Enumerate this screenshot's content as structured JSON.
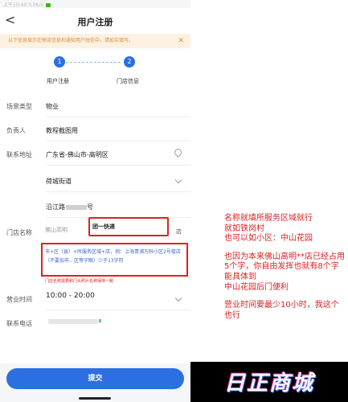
{
  "statusbar": {
    "text": "上午10:40 0.0K/s"
  },
  "navbar": {
    "back": "<",
    "title": "用户注册"
  },
  "notice": {
    "text": "以下信息显示在物流信息和通知用户短信中，请如实填写。",
    "close": "✕"
  },
  "steps": [
    {
      "num": "1",
      "label": "用户注册"
    },
    {
      "num": "2",
      "label": "门店信息"
    }
  ],
  "form": {
    "scene": {
      "label": "场景类型",
      "value": "物业"
    },
    "owner": {
      "label": "负责人",
      "value": "教程截图用"
    },
    "address": {
      "label": "联系地址",
      "region": "广东省-佛山市-高明区",
      "street": "荷城街道",
      "detail": "沿江路",
      "detail_suffix": "号"
    },
    "store": {
      "label": "门店名称",
      "prefix": "佛山高明",
      "name": "团一快递",
      "suffix": "店",
      "hint": "市+区（县）+所服务区域+店，例：上海青浦万科小区2号楼店（不要加市、区等字眼）少于13字符",
      "warn": "门店名称需要和门头照片名称保持一致"
    },
    "hours": {
      "label": "营业时间",
      "value": "10:00 - 20:00"
    },
    "phone": {
      "label": "联系电话"
    }
  },
  "submit": {
    "label": "提交"
  },
  "annotation": {
    "lines": [
      "名称就填所服务区域就行",
      "就如铁岗村",
      "也可以如小区：中山花园",
      "",
      "也因为本来佛山高明**店已经占用5个字，你自由发挥也就有8个字",
      "能具体到",
      "中山花园后门便利",
      "",
      "营业时间要最少10小时，我这个也行"
    ]
  },
  "brand": {
    "text": "日正商城"
  },
  "colors": {
    "accent": "#2c6fe0",
    "highlight": "#e02020",
    "notice_bg": "#fdf1e1",
    "notice_text": "#e08a3a"
  }
}
